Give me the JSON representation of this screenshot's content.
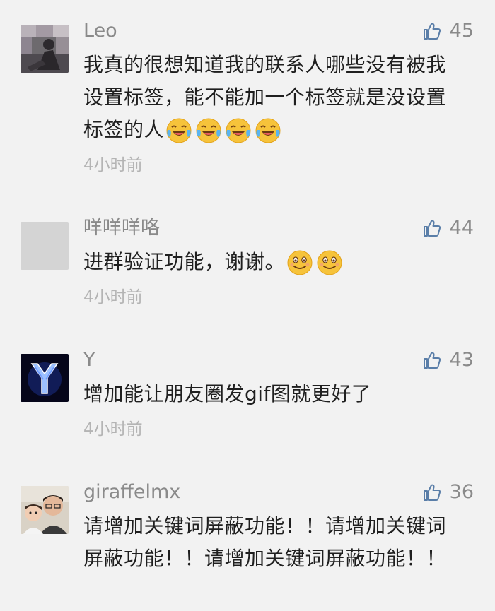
{
  "comments": [
    {
      "name": "Leo",
      "likes": "45",
      "text": "我真的很想知道我的联系人哪些没有被我设置标签，能不能加一个标签就是没设置标签的人",
      "emojis": [
        "laugh-cry-emoji",
        "laugh-cry-emoji",
        "laugh-cry-emoji",
        "laugh-cry-emoji"
      ],
      "time": "4小时前"
    },
    {
      "name": "咩咩咩咯",
      "likes": "44",
      "text": "进群验证功能，谢谢。",
      "emojis": [
        "smile-emoji",
        "smile-emoji"
      ],
      "time": "4小时前"
    },
    {
      "name": "Y",
      "likes": "43",
      "text": "增加能让朋友圈发gif图就更好了",
      "emojis": [],
      "time": "4小时前"
    },
    {
      "name": "giraffelmx",
      "likes": "36",
      "text": "请增加关键词屏蔽功能！！请增加关键词屏蔽功能！！请增加关键词屏蔽功能！！",
      "emojis": [],
      "time": ""
    }
  ],
  "icons": {
    "like": "thumbs-up-icon"
  },
  "colors": {
    "background": "#f2f2f2",
    "muted_text": "#8a8a8a",
    "time_text": "#b4b4b4",
    "body_text": "#1f1f1f",
    "like_icon": "#5a7ea8"
  }
}
